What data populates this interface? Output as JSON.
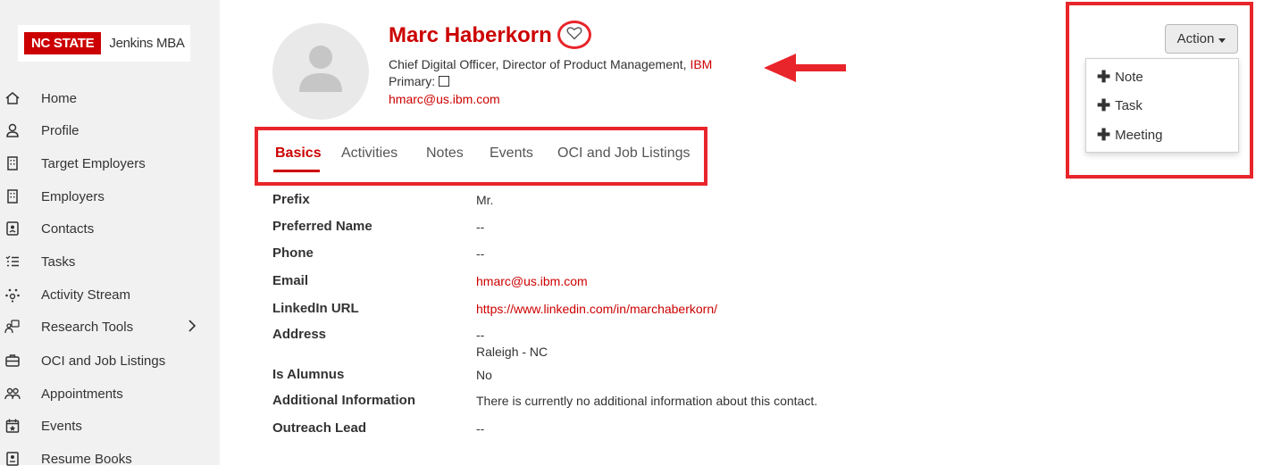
{
  "brand": {
    "logo_text": "NC STATE",
    "program": "Jenkins MBA"
  },
  "sidebar": {
    "items": [
      {
        "label": "Home",
        "icon": "home-icon"
      },
      {
        "label": "Profile",
        "icon": "user-icon"
      },
      {
        "label": "Target Employers",
        "icon": "building-icon"
      },
      {
        "label": "Employers",
        "icon": "building-icon"
      },
      {
        "label": "Contacts",
        "icon": "contact-card-icon"
      },
      {
        "label": "Tasks",
        "icon": "checklist-icon"
      },
      {
        "label": "Activity Stream",
        "icon": "network-icon"
      },
      {
        "label": "Research Tools",
        "icon": "research-icon"
      },
      {
        "label": "OCI and Job Listings",
        "icon": "briefcase-icon"
      },
      {
        "label": "Appointments",
        "icon": "people-icon"
      },
      {
        "label": "Events",
        "icon": "calendar-star-icon"
      },
      {
        "label": "Resume Books",
        "icon": "book-icon"
      }
    ]
  },
  "contact": {
    "name": "Marc Haberkorn",
    "title": "Chief Digital Officer, Director of Product Management, ",
    "company": "IBM",
    "primary_label": "Primary: ",
    "email": "hmarc@us.ibm.com"
  },
  "tabs": [
    "Basics",
    "Activities",
    "Notes",
    "Events",
    "OCI and Job Listings"
  ],
  "fields": [
    {
      "label": "Prefix",
      "value": "Mr."
    },
    {
      "label": "Preferred Name",
      "value": "--"
    },
    {
      "label": "Phone",
      "value": "--"
    },
    {
      "label": "Email",
      "value": "hmarc@us.ibm.com"
    },
    {
      "label": "LinkedIn URL",
      "value": "https://www.linkedin.com/in/marchaberkorn/"
    },
    {
      "label": "Address",
      "value": "--",
      "value2": "Raleigh - NC"
    },
    {
      "label": "Is Alumnus",
      "value": "No"
    },
    {
      "label": "Additional Information",
      "value": "There is currently no additional information about this contact."
    },
    {
      "label": "Outreach Lead",
      "value": "--"
    }
  ],
  "action": {
    "button_label": "Action",
    "menu": [
      "Note",
      "Task",
      "Meeting"
    ]
  },
  "colors": {
    "accent": "#cc0000",
    "annotation": "#e8252a"
  }
}
